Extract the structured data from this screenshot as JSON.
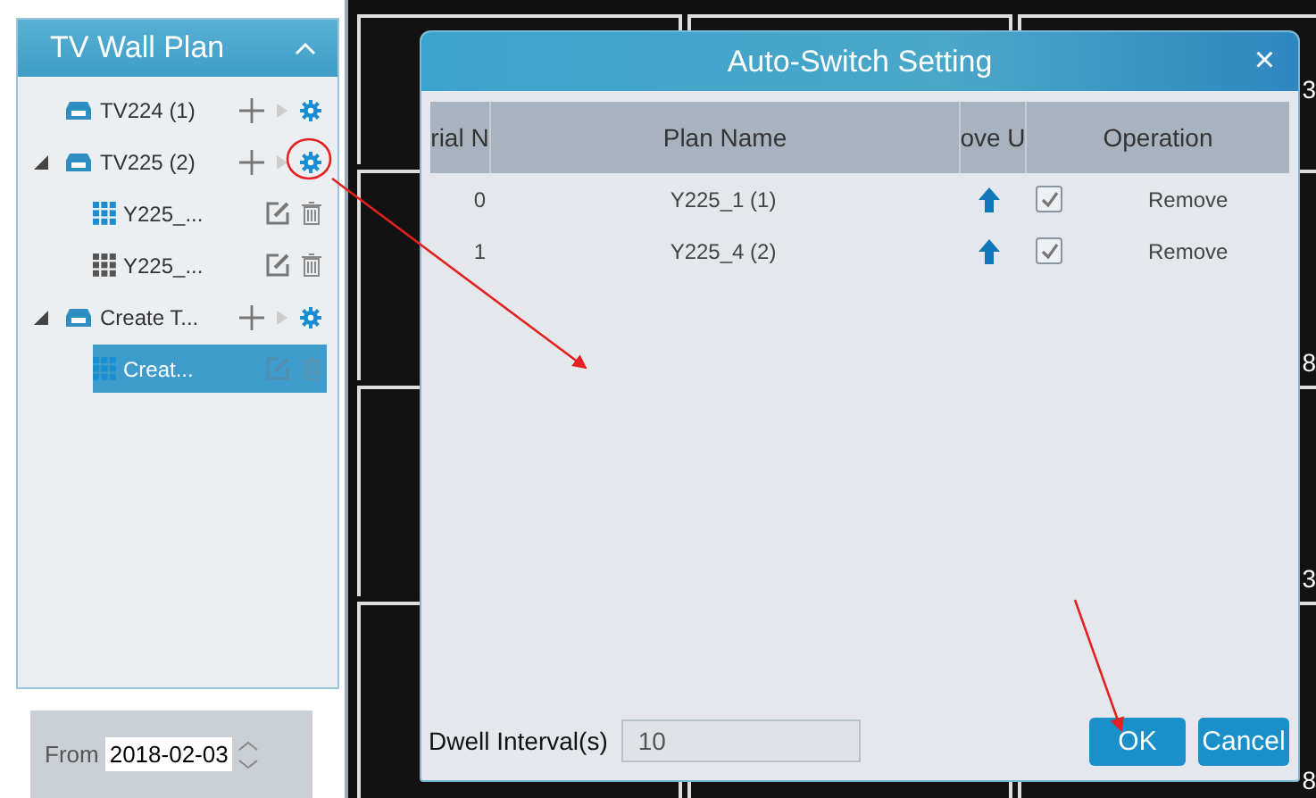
{
  "sidebar": {
    "title": "TV Wall Plan",
    "items": [
      {
        "label": "TV224 (1)",
        "kind": "tv",
        "selected": false
      },
      {
        "label": "TV225 (2)",
        "kind": "tv",
        "selected": false,
        "expanded": true,
        "children": [
          {
            "label": "Y225_...",
            "kind": "plan",
            "selected": false,
            "active": true
          },
          {
            "label": "Y225_...",
            "kind": "plan",
            "selected": false,
            "active": false
          }
        ]
      },
      {
        "label": "Create T...",
        "kind": "tv",
        "selected": false,
        "expanded": true,
        "children": [
          {
            "label": "Creat...",
            "kind": "plan",
            "selected": true,
            "active": true
          }
        ]
      }
    ]
  },
  "date_filter": {
    "label": "From",
    "value": "2018-02-03"
  },
  "wall": {
    "cell_labels": [
      "3",
      "8",
      "3",
      "8"
    ]
  },
  "dialog": {
    "title": "Auto-Switch Setting",
    "close": "×",
    "columns": [
      "rial N",
      "Plan Name",
      "ove U",
      "Operation"
    ],
    "rows": [
      {
        "serial": "0",
        "plan_name": "Y225_1 (1)",
        "checked": true,
        "operation": "Remove"
      },
      {
        "serial": "1",
        "plan_name": "Y225_4 (2)",
        "checked": true,
        "operation": "Remove"
      }
    ],
    "dwell": {
      "label": "Dwell Interval(s)",
      "value": "10"
    },
    "buttons": [
      "OK",
      "Cancel"
    ]
  }
}
